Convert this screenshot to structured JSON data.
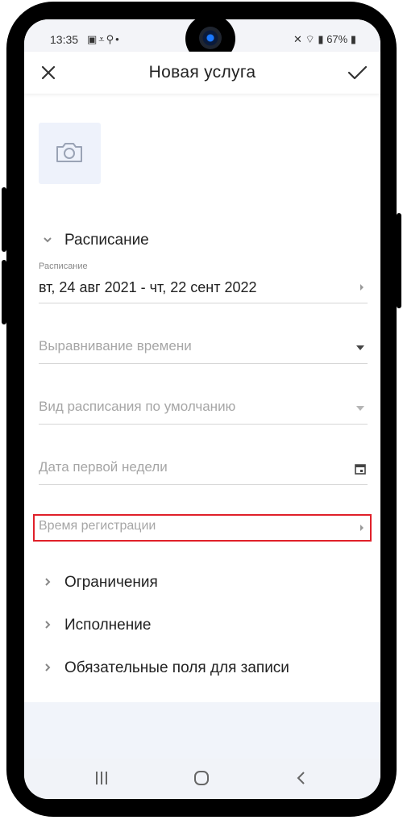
{
  "status_bar": {
    "time": "13:35",
    "left_icons": [
      "image-icon",
      "download-check-icon",
      "search-icon",
      "dot-icon"
    ],
    "battery": "67%"
  },
  "app_bar": {
    "title": "Новая услуга",
    "close_icon": "close-icon",
    "save_icon": "check-icon"
  },
  "photo": {
    "icon": "camera-icon"
  },
  "schedule_section": {
    "title": "Расписание",
    "expanded": true,
    "schedule_field": {
      "label": "Расписание",
      "value": "вт, 24 авг 2021 - чт, 22 сент 2022"
    },
    "time_alignment": {
      "placeholder": "Выравнивание времени"
    },
    "default_view": {
      "placeholder": "Вид расписания по умолчанию"
    },
    "first_week_date": {
      "placeholder": "Дата первой недели"
    },
    "registration_time": {
      "placeholder": "Время регистрации"
    }
  },
  "collapsed_sections": [
    {
      "title": "Ограничения"
    },
    {
      "title": "Исполнение"
    },
    {
      "title": "Обязательные поля для записи"
    }
  ],
  "nav_bar": {
    "buttons": [
      "recents-icon",
      "home-icon",
      "back-icon"
    ]
  },
  "colors": {
    "highlight": "#e0202a",
    "photo_bg": "#eef2fb",
    "placeholder": "#a6a6a6",
    "text": "#222222"
  }
}
